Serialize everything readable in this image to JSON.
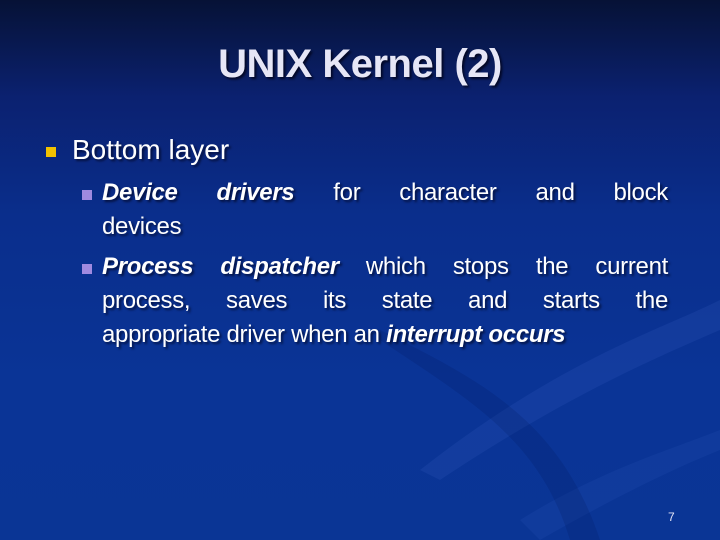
{
  "slide": {
    "title": "UNIX Kernel (2)",
    "bullets": [
      {
        "label": "Bottom layer",
        "bullet_color": "#f2c200",
        "children": [
          {
            "emphasis": "Device drivers",
            "line1_rest": " for character and block",
            "line2": "devices"
          },
          {
            "emphasis": "Process dispatcher",
            "line1_rest": " which stops the current",
            "line2": "process, saves its state and starts the",
            "line3_plain": "appropriate driver when an ",
            "line3_emphasis": "interrupt occurs"
          }
        ],
        "child_bullet_color": "#a08ae0"
      }
    ],
    "page_number": "7"
  }
}
